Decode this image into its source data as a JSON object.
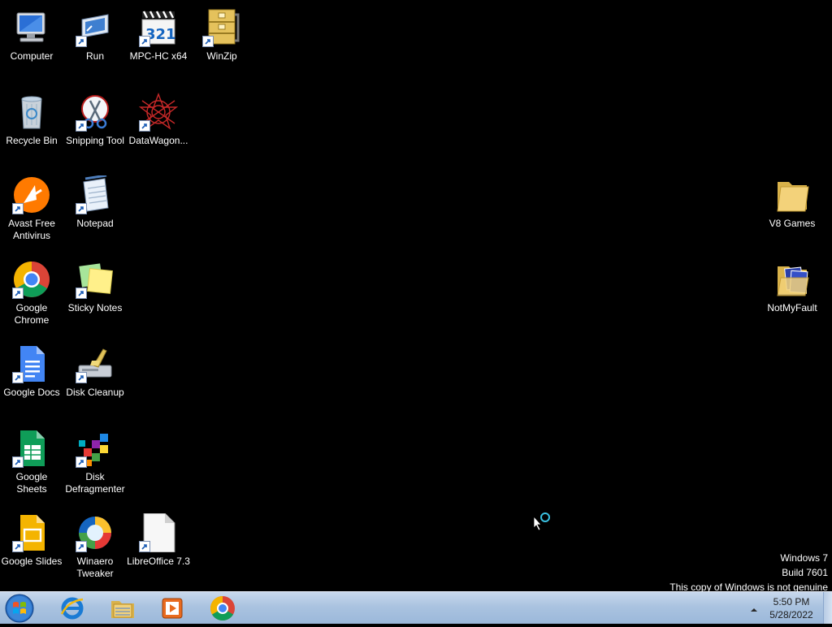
{
  "desktop_icons": {
    "computer": {
      "label": "Computer"
    },
    "run": {
      "label": "Run"
    },
    "mpc": {
      "label": "MPC-HC x64"
    },
    "winzip": {
      "label": "WinZip"
    },
    "recycle": {
      "label": "Recycle Bin"
    },
    "snipping": {
      "label": "Snipping Tool"
    },
    "datawagon": {
      "label": "DataWagon..."
    },
    "avast": {
      "label": "Avast Free Antivirus"
    },
    "notepad": {
      "label": "Notepad"
    },
    "chrome": {
      "label": "Google Chrome"
    },
    "sticky": {
      "label": "Sticky Notes"
    },
    "docs": {
      "label": "Google Docs"
    },
    "cleanup": {
      "label": "Disk Cleanup"
    },
    "sheets": {
      "label": "Google Sheets"
    },
    "defrag": {
      "label": "Disk Defragmenter"
    },
    "slides": {
      "label": "Google Slides"
    },
    "winaero": {
      "label": "Winaero Tweaker"
    },
    "libre": {
      "label": "LibreOffice 7.3"
    },
    "v8games": {
      "label": "V8 Games"
    },
    "notmyfault": {
      "label": "NotMyFault"
    }
  },
  "watermark": {
    "line1": "Windows 7",
    "line2": "Build 7601",
    "line3": "This copy of Windows is not genuine"
  },
  "taskbar": {
    "pinned": [
      "internet-explorer-icon",
      "windows-explorer-icon",
      "media-player-icon",
      "chrome-icon"
    ]
  },
  "clock": {
    "time": "5:50 PM",
    "date": "5/28/2022"
  }
}
